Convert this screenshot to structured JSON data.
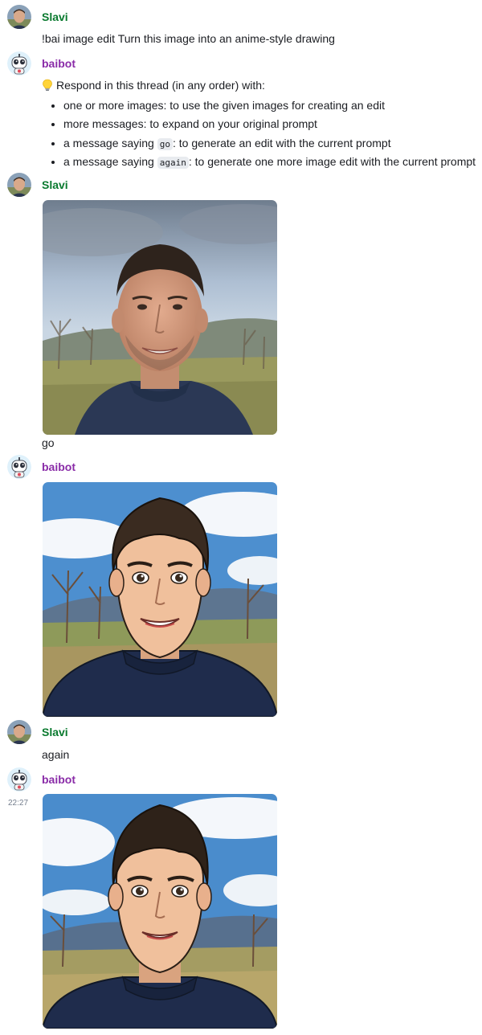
{
  "messages": [
    {
      "sender": "Slavi",
      "text": "!bai image edit Turn this image into an anime-style drawing"
    },
    {
      "sender": "baibot",
      "intro": "Respond in this thread (in any order) with:",
      "intro_icon": "lightbulb-icon",
      "tips": [
        {
          "text": "one or more images: to use the given images for creating an edit"
        },
        {
          "text": "more messages: to expand on your original prompt"
        },
        {
          "prefix": "a message saying ",
          "code": "go",
          "suffix": ": to generate an edit with the current prompt"
        },
        {
          "prefix": "a message saying ",
          "code": "again",
          "suffix": ": to generate one more image edit with the current prompt"
        }
      ]
    },
    {
      "sender": "Slavi",
      "image": "selfie-photo",
      "text": "go"
    },
    {
      "sender": "baibot",
      "image": "anime-portrait"
    },
    {
      "sender": "Slavi",
      "text": "again"
    },
    {
      "sender": "baibot",
      "timestamp": "22:27",
      "image": "anime-portrait"
    }
  ],
  "colors": {
    "slavi_name": "#0a7a2f",
    "bot_name": "#8a2ca8",
    "code_bg": "#e8ebef"
  }
}
